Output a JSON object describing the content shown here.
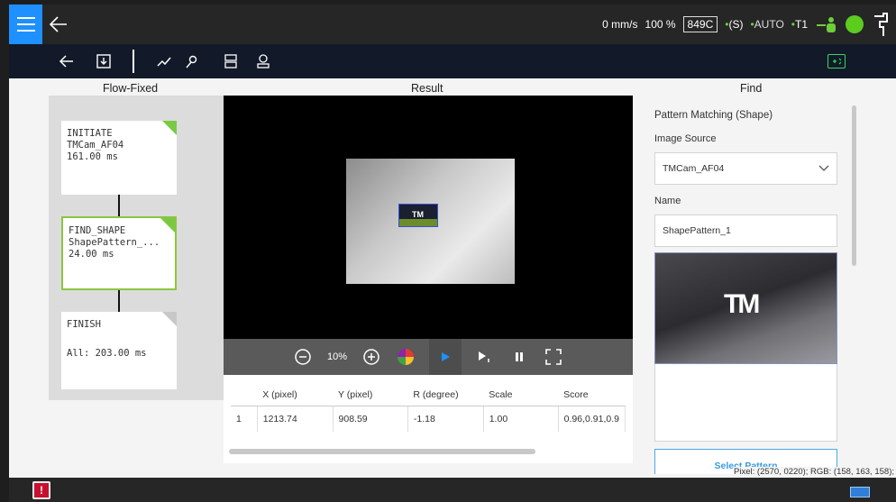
{
  "status": {
    "speed": "0 mm/s",
    "percent": "100 %",
    "code": "849C",
    "safety_symbol": "S",
    "mode": "AUTO",
    "t": "T1"
  },
  "sections": {
    "flow_title": "Flow-Fixed",
    "result_title": "Result",
    "find_title": "Find"
  },
  "flow": [
    {
      "type": "INITIATE",
      "name": "TMCam_AF04",
      "time": "161.00 ms"
    },
    {
      "type": "FIND_SHAPE",
      "name": "ShapePattern_...",
      "time": "24.00 ms"
    },
    {
      "type": "FINISH",
      "name": "",
      "time": "All: 203.00 ms"
    }
  ],
  "viewer": {
    "zoom": "10%",
    "target_text": "TM"
  },
  "table": {
    "headers": [
      "",
      "X (pixel)",
      "Y (pixel)",
      "R (degree)",
      "Scale",
      "Score"
    ],
    "rows": [
      [
        "1",
        "1213.74",
        "908.59",
        "-1.18",
        "1.00",
        "0.96,0.91,0.9"
      ]
    ]
  },
  "find": {
    "heading": "Pattern Matching (Shape)",
    "image_source_label": "Image Source",
    "image_source_value": "TMCam_AF04",
    "name_label": "Name",
    "name_value": "ShapePattern_1",
    "pattern_logo": "TM",
    "select_button": "Select Pattern"
  },
  "pixel_info": "Pixel: (2570, 0220); RGB: (158, 163, 158);",
  "colors": {
    "menu_blue": "#1e90ff",
    "accent_green": "#7ac943",
    "alert_red": "#c8102e"
  }
}
